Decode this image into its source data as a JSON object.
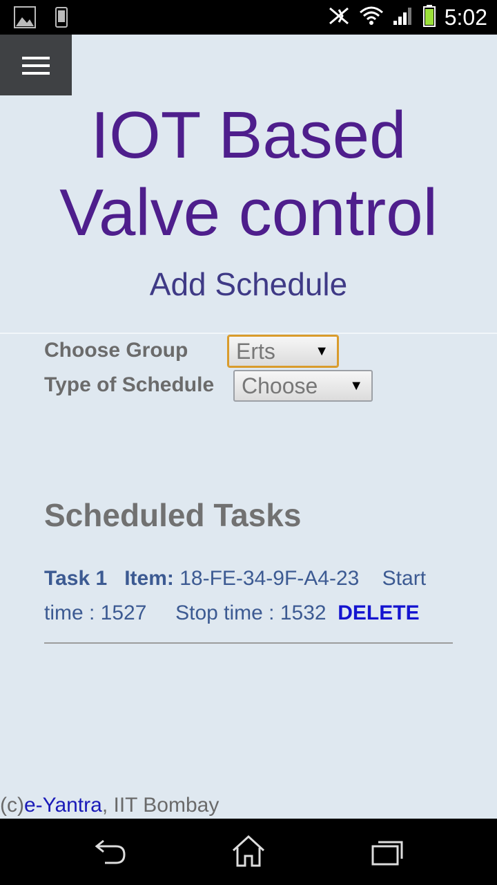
{
  "status_bar": {
    "time": "5:02",
    "icons": [
      "image-icon",
      "phone-icon",
      "no-nfc-icon",
      "wifi-icon",
      "signal-icon",
      "battery-icon"
    ]
  },
  "header": {
    "menu_icon": "hamburger-icon",
    "title_line1": "IOT Based",
    "title_line2": "Valve control",
    "subtitle": "Add Schedule"
  },
  "form": {
    "group_label": "Choose Group",
    "group_value": "Erts",
    "schedule_label": "Type of Schedule",
    "schedule_value": "Choose",
    "arrow": "▼"
  },
  "tasks": {
    "heading": "Scheduled Tasks",
    "items": [
      {
        "name": "Task 1",
        "item_label": "Item:",
        "item_value": "18-FE-34-9F-A4-23",
        "start": "Start time : 1527",
        "stop": "Stop time : 1532",
        "delete_label": "DELETE"
      }
    ]
  },
  "footer": {
    "prefix": "(c)",
    "link": "e-Yantra",
    "suffix": ", IIT Bombay"
  },
  "nav_bar": {
    "icons": [
      "back-icon",
      "home-icon",
      "recents-icon"
    ]
  },
  "colors": {
    "background": "#dfe8f0",
    "title": "#4e1e8c",
    "subtitle": "#3f3a86",
    "task_text": "#3c5a92",
    "delete": "#1414d0",
    "focus_border": "#d99b2b"
  }
}
